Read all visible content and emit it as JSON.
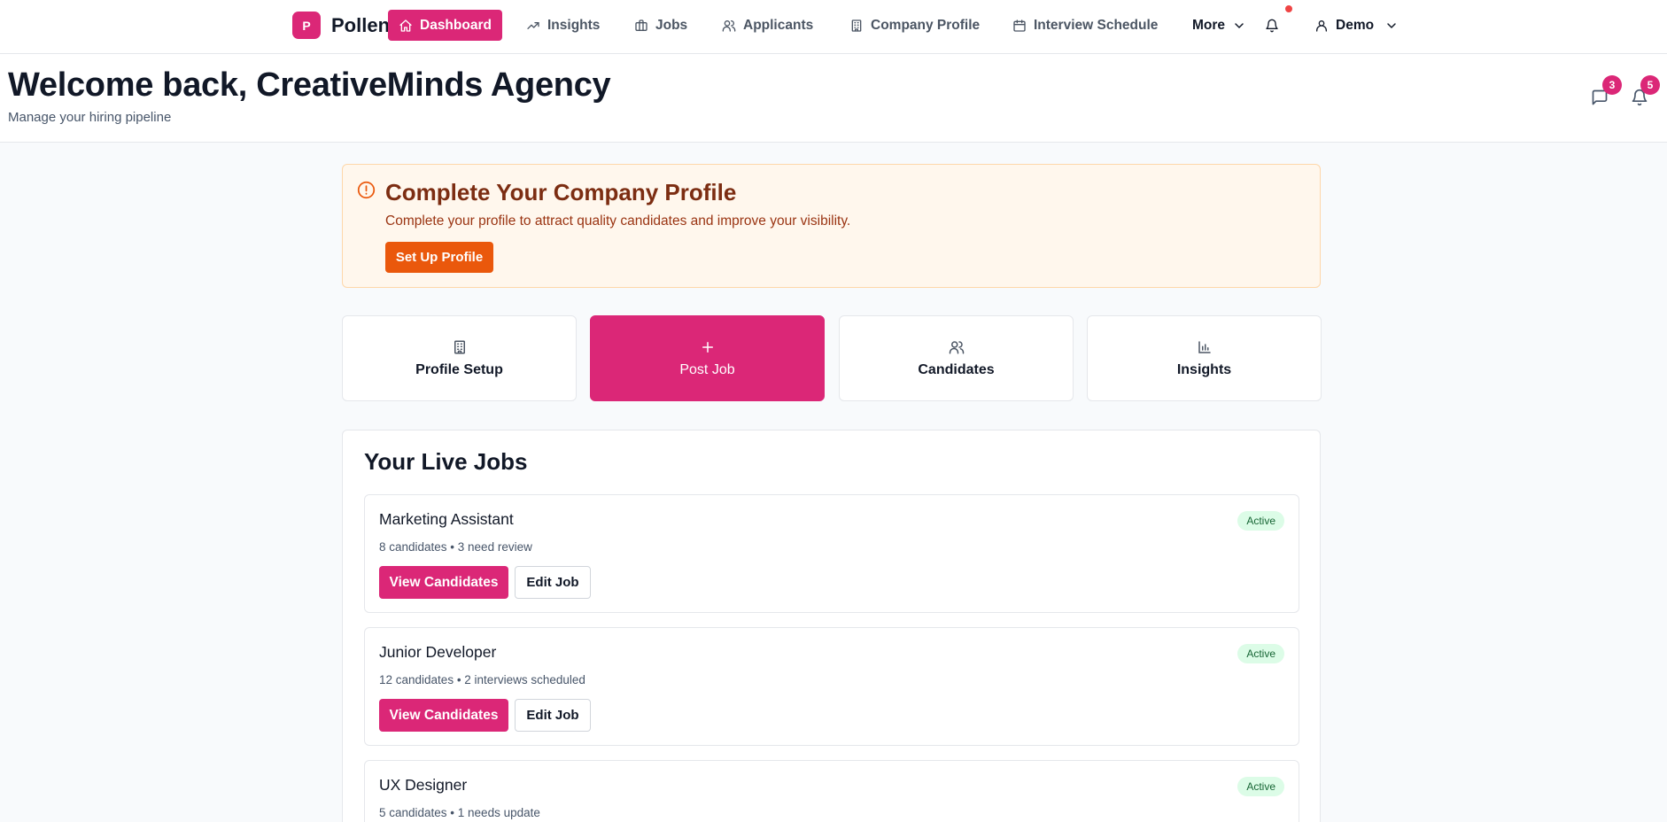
{
  "nav": {
    "brand_initial": "P",
    "brand_name": "Pollen",
    "items": [
      {
        "label": "Dashboard",
        "icon": "home-icon"
      },
      {
        "label": "Insights",
        "icon": "trending-up-icon"
      },
      {
        "label": "Jobs",
        "icon": "briefcase-icon"
      },
      {
        "label": "Applicants",
        "icon": "users-icon"
      },
      {
        "label": "Company Profile",
        "icon": "building-icon"
      },
      {
        "label": "Interview Schedule",
        "icon": "calendar-icon"
      }
    ],
    "more_label": "More",
    "user_label": "Demo"
  },
  "header": {
    "title": "Welcome back, CreativeMinds Agency",
    "subtitle": "Manage your hiring pipeline",
    "messages_count": "3",
    "notifications_count": "5"
  },
  "banner": {
    "title": "Complete Your Company Profile",
    "text": "Complete your profile to attract quality candidates and improve your visibility.",
    "button_label": "Set Up Profile"
  },
  "quick_actions": [
    {
      "label": "Profile Setup",
      "icon": "building-icon"
    },
    {
      "label": "Post Job",
      "icon": "plus-icon"
    },
    {
      "label": "Candidates",
      "icon": "users-icon"
    },
    {
      "label": "Insights",
      "icon": "bar-chart-icon"
    }
  ],
  "live_jobs": {
    "title": "Your Live Jobs",
    "view_label": "View Candidates",
    "edit_label": "Edit Job",
    "jobs": [
      {
        "title": "Marketing Assistant",
        "meta": "8 candidates • 3 need review",
        "status": "Active"
      },
      {
        "title": "Junior Developer",
        "meta": "12 candidates • 2 interviews scheduled",
        "status": "Active"
      },
      {
        "title": "UX Designer",
        "meta": "5 candidates • 1 needs update",
        "status": "Active"
      }
    ]
  },
  "colors": {
    "brand": "#db2777",
    "warning": "#ea580c",
    "success_bg": "#dcfce7",
    "success_text": "#166534"
  }
}
